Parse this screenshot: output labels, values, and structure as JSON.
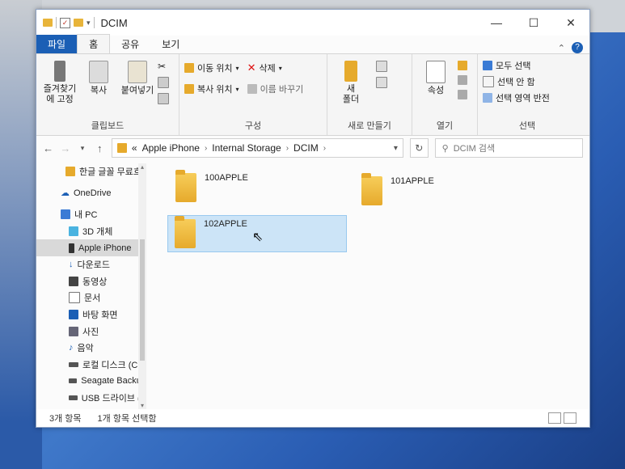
{
  "window": {
    "title": "DCIM",
    "min": "—",
    "max": "☐",
    "close": "✕"
  },
  "tabs": [
    {
      "label": "파일"
    },
    {
      "label": "홈"
    },
    {
      "label": "공유"
    },
    {
      "label": "보기"
    }
  ],
  "ribbon": {
    "clipboard": {
      "pin": "즐겨찾기에 고정",
      "copy": "복사",
      "paste": "붙여넣기",
      "caption": "클립보드"
    },
    "organize": {
      "move_to": "이동 위치",
      "delete": "삭제",
      "copy_to": "복사 위치",
      "rename": "이름 바꾸기",
      "caption": "구성"
    },
    "new": {
      "new_folder_line1": "새",
      "new_folder_line2": "폴더",
      "caption": "새로 만들기"
    },
    "open": {
      "properties": "속성",
      "caption": "열기"
    },
    "select": {
      "select_all": "모두 선택",
      "select_none": "선택 안 함",
      "invert": "선택 영역 반전",
      "caption": "선택"
    }
  },
  "address": {
    "prefix": "«",
    "path": [
      "Apple iPhone",
      "Internal Storage",
      "DCIM"
    ],
    "search_placeholder": "DCIM 검색"
  },
  "sidebar": [
    {
      "label": "한글 글꼴 무료흐",
      "icon": "folder-icon"
    },
    {
      "label": "OneDrive",
      "icon": "cloud-icon"
    },
    {
      "label": "내 PC",
      "icon": "pc-icon"
    },
    {
      "label": "3D 개체",
      "icon": "cube-icon"
    },
    {
      "label": "Apple iPhone",
      "icon": "phone-icon",
      "selected": true
    },
    {
      "label": "다운로드",
      "icon": "download-icon"
    },
    {
      "label": "동영상",
      "icon": "video-icon"
    },
    {
      "label": "문서",
      "icon": "document-icon"
    },
    {
      "label": "바탕 화면",
      "icon": "desktop-icon"
    },
    {
      "label": "사진",
      "icon": "picture-icon"
    },
    {
      "label": "음악",
      "icon": "music-icon"
    },
    {
      "label": "로컬 디스크 (C:)",
      "icon": "drive-icon"
    },
    {
      "label": "Seagate Backup",
      "icon": "drive-icon"
    },
    {
      "label": "USB 드라이브 (E",
      "icon": "usb-drive-icon"
    }
  ],
  "files": [
    {
      "name": "100APPLE"
    },
    {
      "name": "101APPLE"
    },
    {
      "name": "102APPLE",
      "selected": true
    }
  ],
  "status": {
    "count": "3개 항목",
    "selection": "1개 항목 선택함"
  },
  "colors": {
    "accent": "#1b5fb5",
    "folder": "#e6aa2c",
    "selection": "#cce4f7"
  }
}
